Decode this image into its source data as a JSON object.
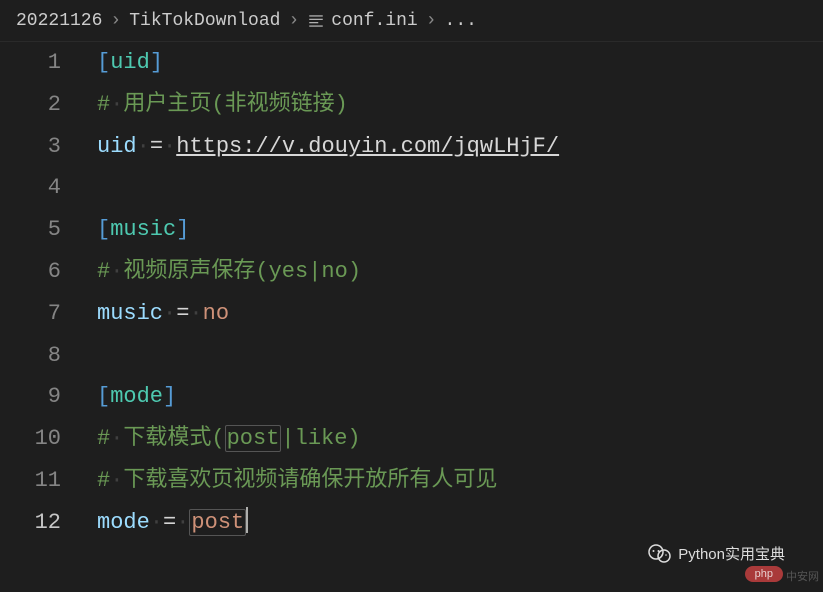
{
  "breadcrumb": {
    "p1": "20221126",
    "p2": "TikTokDownload",
    "p3": "conf.ini",
    "p4": "..."
  },
  "editor": {
    "lines": [
      {
        "num": "1"
      },
      {
        "num": "2"
      },
      {
        "num": "3"
      },
      {
        "num": "4"
      },
      {
        "num": "5"
      },
      {
        "num": "6"
      },
      {
        "num": "7"
      },
      {
        "num": "8"
      },
      {
        "num": "9"
      },
      {
        "num": "10"
      },
      {
        "num": "11"
      },
      {
        "num": "12"
      }
    ],
    "code": {
      "l1_section": "uid",
      "l2_comment": "用户主页(非视频链接)",
      "l3_key": "uid",
      "l3_url": "https://v.douyin.com/jqwLHjF/",
      "l5_section": "music",
      "l6_comment": "视频原声保存(yes|no)",
      "l7_key": "music",
      "l7_val": "no",
      "l9_section": "mode",
      "l10_comment": "下载模式(",
      "l10_hl": "post",
      "l10_comment2": "|like)",
      "l11_comment": "下载喜欢页视频请确保开放所有人可见",
      "l12_key": "mode",
      "l12_val": "post"
    }
  },
  "watermark": "Python实用宝典",
  "php_badge": "php",
  "side_text": "中安网"
}
